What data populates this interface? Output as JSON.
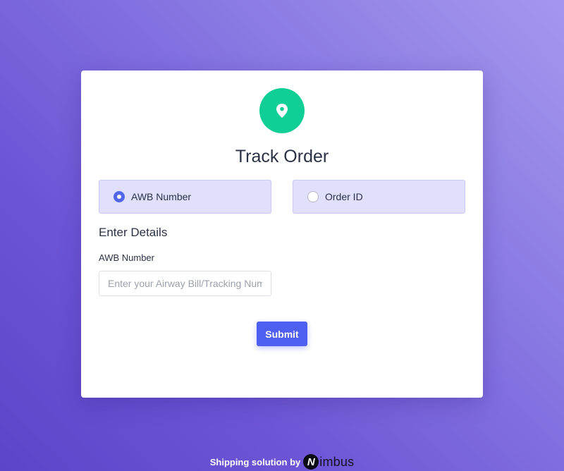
{
  "colors": {
    "accent": "#4f5ff0",
    "pin_circle": "#0fcf96",
    "radio_box_bg": "#e0e0fd",
    "background_start": "#a597ee",
    "background_end": "#5c45c8"
  },
  "card": {
    "icon": "map-pin-icon",
    "title": "Track Order",
    "options": [
      {
        "label": "AWB Number",
        "selected": true
      },
      {
        "label": "Order ID",
        "selected": false
      }
    ],
    "section_title": "Enter Details",
    "field": {
      "label": "AWB Number",
      "placeholder": "Enter your Airway Bill/Tracking Number",
      "value": ""
    },
    "submit_label": "Submit"
  },
  "footer": {
    "text": "Shipping solution by",
    "brand_mark": "N",
    "brand_name": "imbus"
  }
}
